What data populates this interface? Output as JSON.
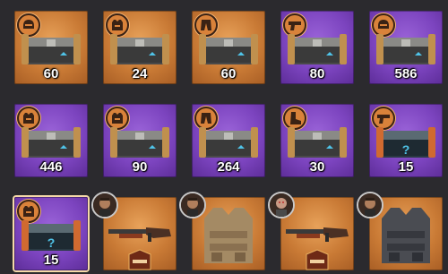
{
  "inventory": {
    "row1": [
      {
        "icon": "helmet-icon",
        "quantity": "60",
        "rarity": "orange"
      },
      {
        "icon": "vest-icon",
        "quantity": "24",
        "rarity": "orange"
      },
      {
        "icon": "pants-icon",
        "quantity": "60",
        "rarity": "orange"
      },
      {
        "icon": "pistol-icon",
        "quantity": "80",
        "rarity": "purple"
      },
      {
        "icon": "helmet-icon",
        "quantity": "586",
        "rarity": "purple"
      }
    ],
    "row2": [
      {
        "icon": "vest-icon",
        "quantity": "446",
        "rarity": "purple"
      },
      {
        "icon": "vest-icon",
        "quantity": "90",
        "rarity": "purple"
      },
      {
        "icon": "pants-icon",
        "quantity": "264",
        "rarity": "purple"
      },
      {
        "icon": "boots-icon",
        "quantity": "30",
        "rarity": "purple"
      },
      {
        "icon": "pistol-icon",
        "quantity": "15",
        "rarity": "purple"
      }
    ],
    "row3": [
      {
        "icon": "vest-icon",
        "quantity": "15",
        "rarity": "purple",
        "selected": true
      },
      {
        "item": "shotgun",
        "rarity": "orange"
      },
      {
        "item": "tactical-vest-tan",
        "rarity": "orange"
      },
      {
        "item": "shotgun",
        "rarity": "orange"
      },
      {
        "item": "tactical-vest-dark",
        "rarity": "orange"
      }
    ]
  },
  "colors": {
    "orange": "#c97a35",
    "purple": "#7c44bf",
    "background": "#2b2a2e"
  }
}
